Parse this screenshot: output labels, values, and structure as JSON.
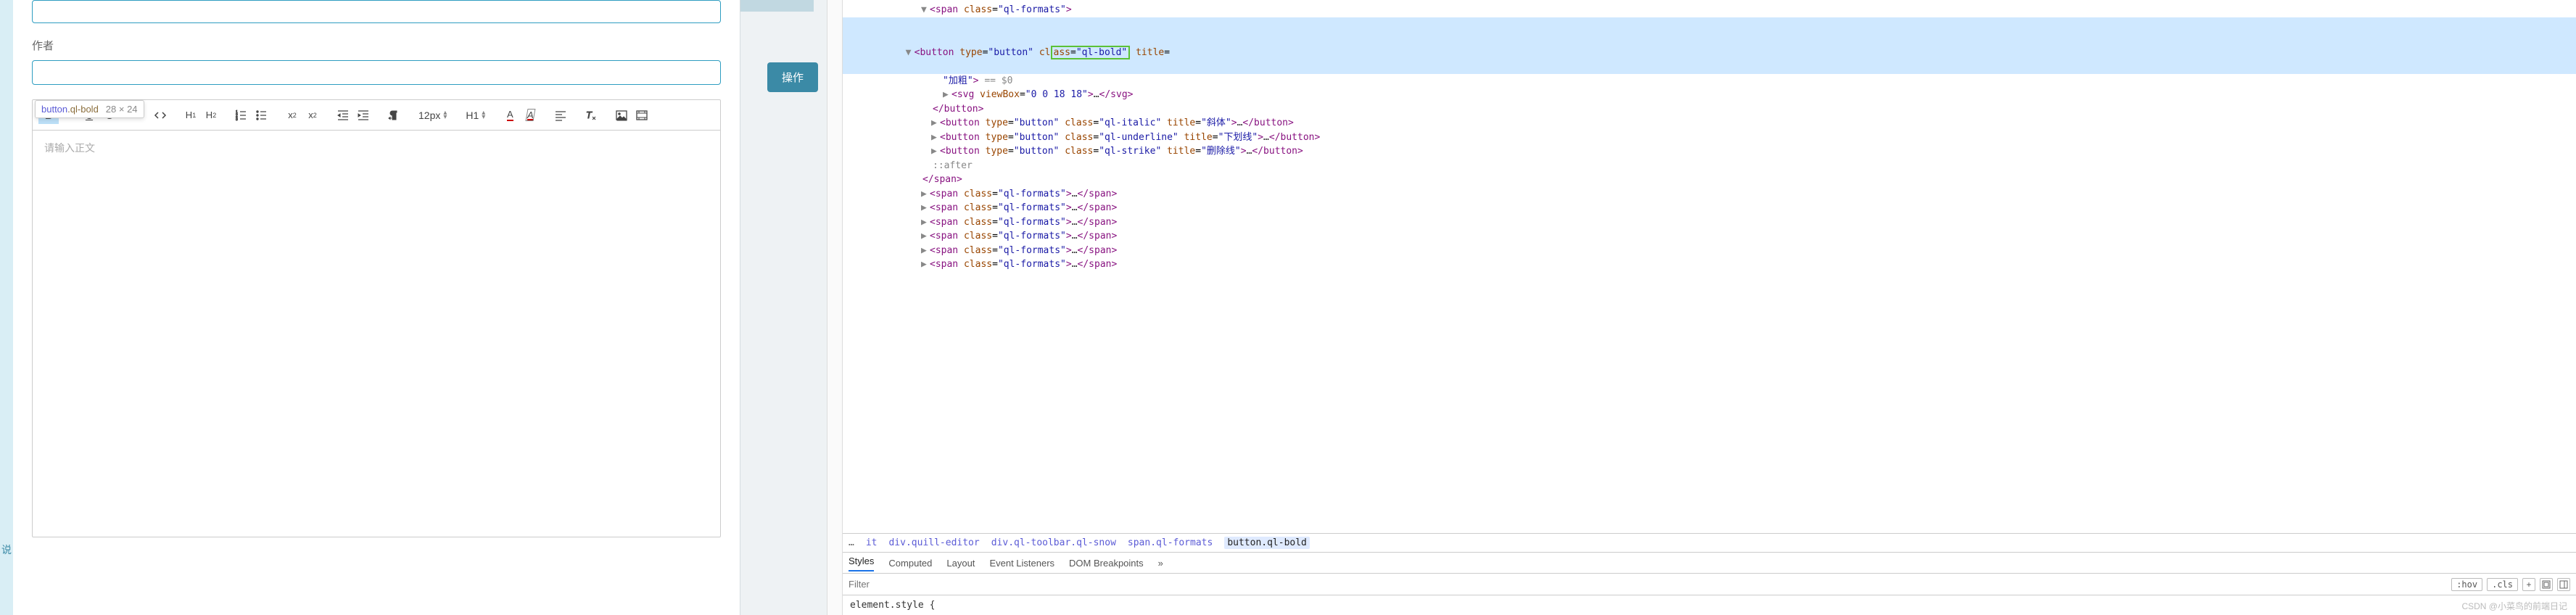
{
  "form": {
    "author_label": "作者",
    "editor_placeholder": "请输入正文"
  },
  "tooltip": {
    "sel_tag": "button",
    "sel_class": ".ql-bold",
    "dims": "28 × 24"
  },
  "toolbar": {
    "font_size": "12px",
    "header_label": "H1"
  },
  "side": {
    "action_label": "操作"
  },
  "dom": {
    "line0": "<span class=\"ql-formats\">",
    "line1a": "<button type=\"button\" cl",
    "line1b": "ass=\"ql-bold\"",
    "line1c": " title=",
    "line2": "\"加粗\"> == $0",
    "line3": "<svg viewBox=\"0 0 18 18\">…</svg>",
    "line4": "</button>",
    "line5": "<button type=\"button\" class=\"ql-italic\" title=\"斜体\">…</button>",
    "line6": "<button type=\"button\" class=\"ql-underline\" title=\"下划线\">…</button>",
    "line7": "<button type=\"button\" class=\"ql-strike\" title=\"删除线\">…</button>",
    "line8": "::after",
    "line9": "</span>",
    "spanrep": "<span class=\"ql-formats\">…</span>"
  },
  "breadcrumbs": {
    "items": [
      "…",
      "it",
      "div.quill-editor",
      "div.ql-toolbar.ql-snow",
      "span.ql-formats",
      "button.ql-bold"
    ]
  },
  "tabs": {
    "items": [
      "Styles",
      "Computed",
      "Layout",
      "Event Listeners",
      "DOM Breakpoints"
    ],
    "more": "»"
  },
  "filter": {
    "placeholder": "Filter",
    "hov": ":hov",
    "cls": ".cls",
    "plus": "+"
  },
  "styles": {
    "rule": "element.style {"
  },
  "watermark": "CSDN @小菜鸟的前端日记",
  "left_edge_text": "说"
}
